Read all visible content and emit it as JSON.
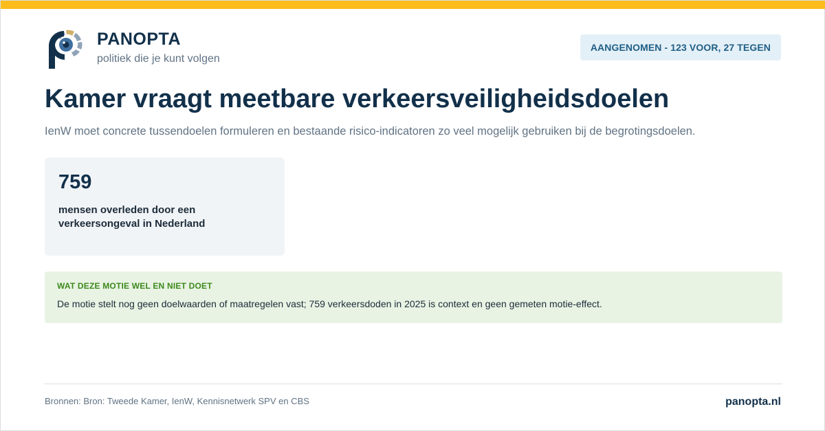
{
  "brand": {
    "name": "PANOPTA",
    "tagline": "politiek die je kunt volgen",
    "colors": {
      "accent": "#fbbc1c",
      "navy": "#12304a",
      "eye_blue": "#3f6fa0",
      "segment_gold": "#d2b06a",
      "segment_grey": "#8fa3b8"
    }
  },
  "status": {
    "label": "AANGENOMEN - 123 VOOR, 27 TEGEN",
    "color": "#1f5e86"
  },
  "headline": {
    "title": "Kamer vraagt meetbare verkeersveiligheidsdoelen",
    "subtitle": "IenW moet concrete tussendoelen formuleren en bestaande risico-indicatoren zo veel mogelijk gebruiken bij de begrotingsdoelen."
  },
  "stat": {
    "value": "759",
    "label": "mensen overleden door een verkeersongeval in Nederland"
  },
  "note": {
    "heading": "WAT DEZE MOTIE WEL EN NIET DOET",
    "text": "De motie stelt nog geen doelwaarden of maatregelen vast; 759 verkeersdoden in 2025 is context en geen gemeten motie-effect."
  },
  "footer": {
    "sources": "Bronnen: Bron: Tweede Kamer, IenW, Kennisnetwerk SPV en CBS",
    "site": "panopta.nl"
  }
}
